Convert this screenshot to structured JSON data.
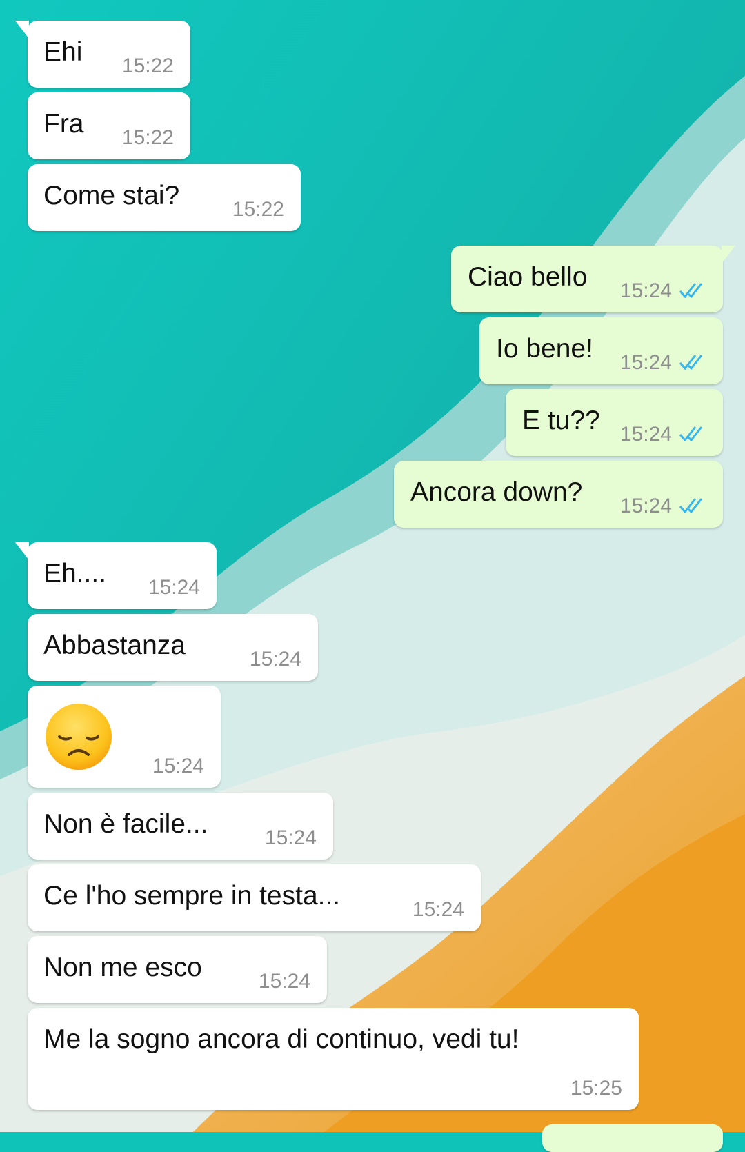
{
  "chat": {
    "messages": [
      {
        "text": "Ehi",
        "time": "15:22",
        "direction": "incoming",
        "status": ""
      },
      {
        "text": "Fra",
        "time": "15:22",
        "direction": "incoming",
        "status": ""
      },
      {
        "text": "Come stai?",
        "time": "15:22",
        "direction": "incoming",
        "status": ""
      },
      {
        "text": "Ciao bello",
        "time": "15:24",
        "direction": "outgoing",
        "status": "read"
      },
      {
        "text": "Io bene!",
        "time": "15:24",
        "direction": "outgoing",
        "status": "read"
      },
      {
        "text": "E tu??",
        "time": "15:24",
        "direction": "outgoing",
        "status": "read"
      },
      {
        "text": "Ancora down?",
        "time": "15:24",
        "direction": "outgoing",
        "status": "read"
      },
      {
        "text": "Eh....",
        "time": "15:24",
        "direction": "incoming",
        "status": ""
      },
      {
        "text": "Abbastanza",
        "time": "15:24",
        "direction": "incoming",
        "status": ""
      },
      {
        "text": "",
        "emoji": "disappointed-face-emoji",
        "time": "15:24",
        "direction": "incoming",
        "status": ""
      },
      {
        "text": "Non è facile...",
        "time": "15:24",
        "direction": "incoming",
        "status": ""
      },
      {
        "text": "Ce l'ho sempre in testa...",
        "time": "15:24",
        "direction": "incoming",
        "status": ""
      },
      {
        "text": "Non me esco",
        "time": "15:24",
        "direction": "incoming",
        "status": ""
      },
      {
        "text": "Me la sogno ancora di continuo, vedi tu!",
        "time": "15:25",
        "direction": "incoming",
        "status": ""
      }
    ]
  },
  "colors": {
    "incoming_bubble": "#ffffff",
    "outgoing_bubble": "#e6fdd3",
    "read_ticks": "#34b7f1",
    "timestamp": "#8e8e8e"
  }
}
